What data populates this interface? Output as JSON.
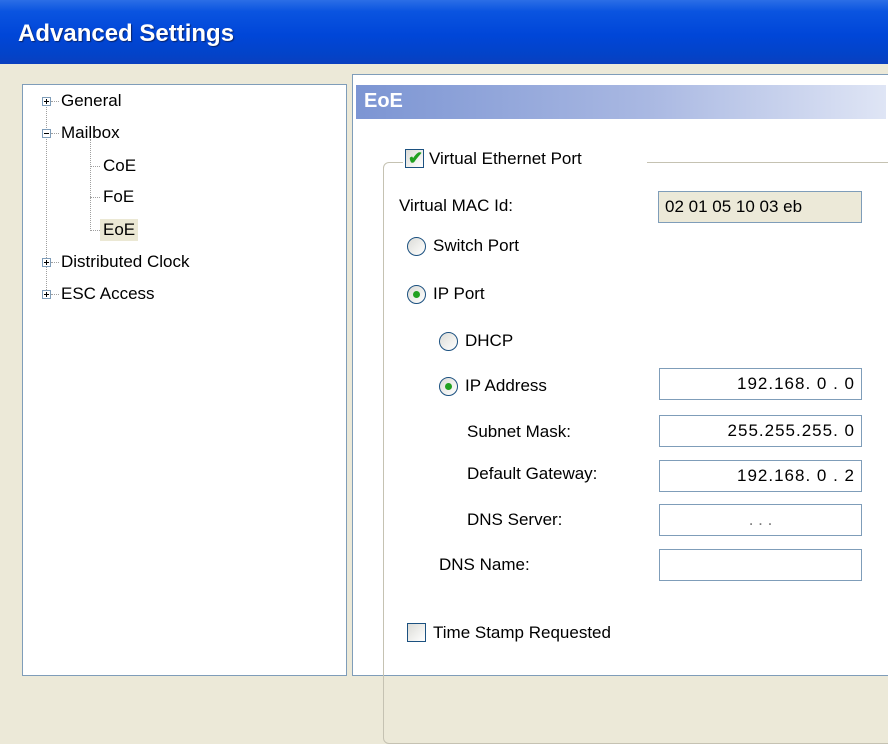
{
  "window": {
    "title": "Advanced Settings"
  },
  "tree": {
    "items": [
      {
        "label": "General",
        "expander": "plus"
      },
      {
        "label": "Mailbox",
        "expander": "minus"
      },
      {
        "label": "CoE"
      },
      {
        "label": "FoE"
      },
      {
        "label": "EoE",
        "selected": true
      },
      {
        "label": "Distributed Clock",
        "expander": "plus"
      },
      {
        "label": "ESC Access",
        "expander": "plus"
      }
    ]
  },
  "content": {
    "section_title": "EoE",
    "virtual_ethernet_port": {
      "label": "Virtual Ethernet Port",
      "checked": true
    },
    "virtual_mac": {
      "label": "Virtual MAC Id:",
      "value": "02 01 05 10 03 eb"
    },
    "switch_port": {
      "label": "Switch Port",
      "selected": false
    },
    "ip_port": {
      "label": "IP Port",
      "selected": true
    },
    "dhcp": {
      "label": "DHCP",
      "selected": false
    },
    "ip_address": {
      "label": "IP Address",
      "selected": true,
      "value": "192.168.  0  .  0"
    },
    "subnet_mask": {
      "label": "Subnet Mask:",
      "value": "255.255.255.  0"
    },
    "default_gateway": {
      "label": "Default Gateway:",
      "value": "192.168.  0  .  2"
    },
    "dns_server": {
      "label": "DNS Server:",
      "value": ".       .       ."
    },
    "dns_name": {
      "label": "DNS Name:",
      "value": ""
    },
    "time_stamp": {
      "label": "Time Stamp Requested",
      "checked": false
    }
  },
  "colors": {
    "title_bar": "#0046d8",
    "section_header": "#7c95d3",
    "check_green": "#21a121",
    "field_border": "#7f9db9"
  }
}
